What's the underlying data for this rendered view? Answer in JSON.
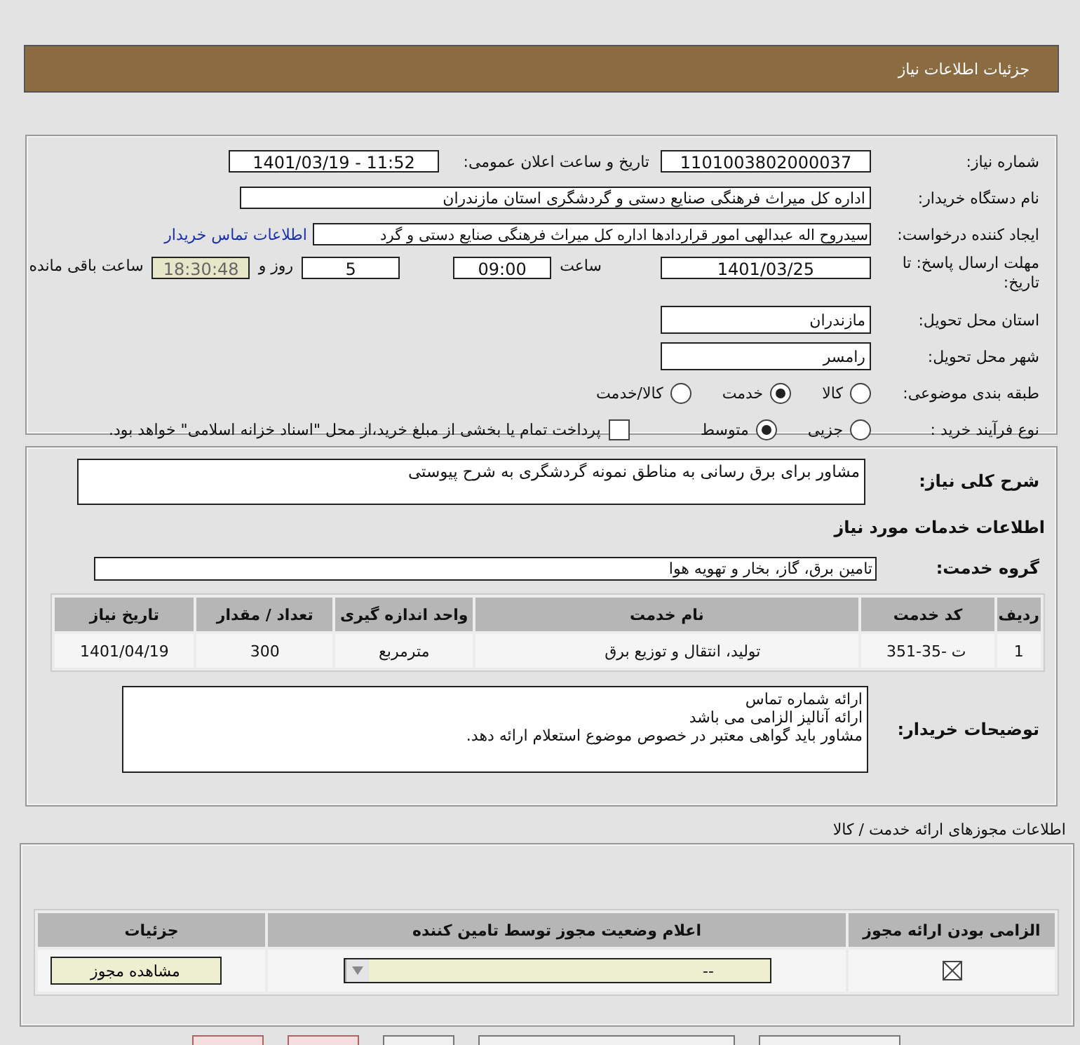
{
  "page_title": "جزئیات اطلاعات نیاز",
  "need_number": {
    "label": "شماره نیاز:",
    "value": "1101003802000037"
  },
  "announce": {
    "label": "تاریخ و ساعت اعلان عمومی:",
    "value": "1401/03/19 - 11:52"
  },
  "buyer_org": {
    "label": "نام دستگاه خریدار:",
    "value": "اداره کل میراث فرهنگی  صنایع دستی و گردشگری استان مازندران"
  },
  "requester": {
    "label": "ایجاد کننده درخواست:",
    "value": "سیدروح اله عبدالهی امور قراردادها اداره کل میراث فرهنگی  صنایع دستی و گرد",
    "link": "اطلاعات تماس خریدار"
  },
  "deadline": {
    "label": "مهلت ارسال پاسخ: تا تاریخ:",
    "date": "1401/03/25",
    "time_label": "ساعت",
    "time": "09:00",
    "days": "5",
    "days_label": "روز و",
    "remaining": "18:30:48",
    "remaining_label": "ساعت باقی مانده"
  },
  "province": {
    "label": "استان محل تحویل:",
    "value": "مازندران"
  },
  "city": {
    "label": "شهر محل تحویل:",
    "value": "رامسر"
  },
  "category": {
    "label": "طبقه بندی موضوعی:",
    "options": [
      {
        "label": "کالا",
        "selected": false
      },
      {
        "label": "خدمت",
        "selected": true
      },
      {
        "label": "کالا/خدمت",
        "selected": false
      }
    ]
  },
  "purchase_process": {
    "label": "نوع فرآیند خرید :",
    "options": [
      {
        "label": "جزیی",
        "selected": false
      },
      {
        "label": "متوسط",
        "selected": true
      }
    ],
    "payment": {
      "checked": false,
      "text": "پرداخت تمام یا بخشی از مبلغ خرید،از محل \"اسناد خزانه اسلامی\" خواهد بود."
    }
  },
  "description": {
    "label": "شرح کلی نیاز:",
    "value": "مشاور برای برق رسانی به مناطق نمونه گردشگری به شرح پیوستی"
  },
  "services_heading": "اطلاعات خدمات مورد نیاز",
  "service_group": {
    "label": "گروه خدمت:",
    "value": "تامین برق، گاز، بخار و تهویه هوا"
  },
  "services_table": {
    "columns": [
      "ردیف",
      "کد خدمت",
      "نام خدمت",
      "واحد اندازه گیری",
      "تعداد / مقدار",
      "تاریخ نیاز"
    ],
    "rows": [
      [
        "1",
        "ت -35-351",
        "تولید، انتقال و توزیع برق",
        "مترمربع",
        "300",
        "1401/04/19"
      ]
    ]
  },
  "buyer_notes": {
    "label": "توضیحات خریدار:",
    "lines": [
      "ارائه شماره تماس",
      "ارائه آنالیز الزامی می باشد",
      "مشاور باید گواهی معتبر در خصوص موضوع  استعلام ارائه دهد."
    ]
  },
  "permits": {
    "heading": "اطلاعات مجوزهای ارائه خدمت / کالا",
    "columns": [
      "الزامی بودن ارائه مجوز",
      "اعلام وضعیت مجوز توسط تامین کننده",
      "جزئیات"
    ],
    "rows": [
      {
        "required": true,
        "status": "--",
        "button": "مشاهده مجوز"
      }
    ]
  }
}
